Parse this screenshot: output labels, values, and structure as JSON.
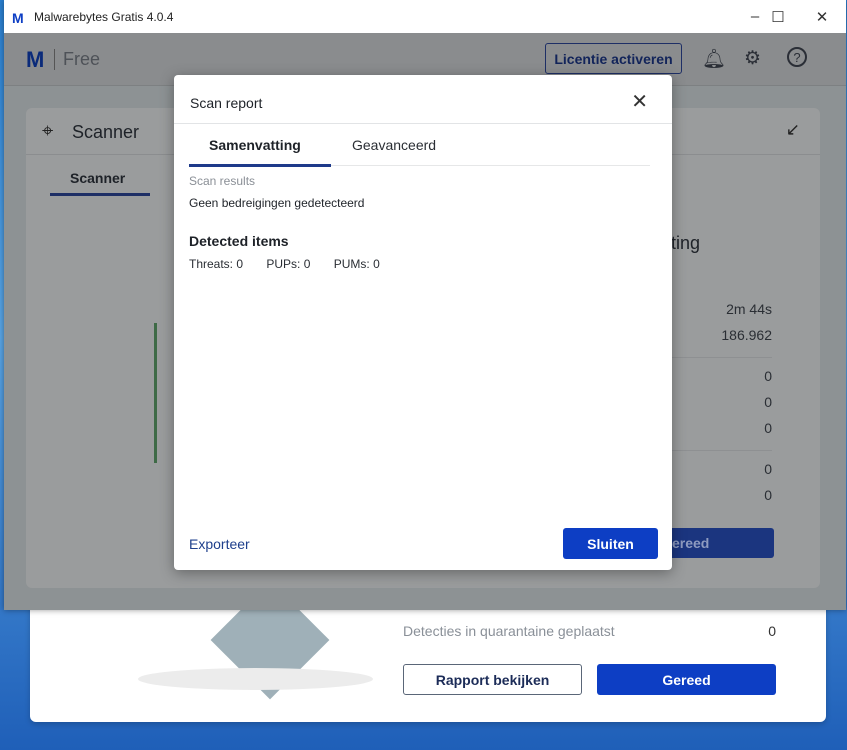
{
  "window": {
    "title": "Malwarebytes Gratis  4.0.4",
    "minimize": "–",
    "maximize": "☐",
    "close": "✕"
  },
  "header": {
    "logo": "M",
    "edition": "Free",
    "license_button": "Licentie activeren",
    "bell": "🔔",
    "gear": "⚙",
    "help": "?"
  },
  "scanner_card": {
    "title": "Scanner",
    "tab": "Scanner",
    "heading_partial": "tting",
    "values": [
      "2m 44s",
      "186.962",
      "0",
      "0",
      "0",
      "0",
      "0"
    ],
    "done_partial": "ereed"
  },
  "background_card": {
    "label": "Detecties in quarantaine geplaatst",
    "value": "0",
    "report_button": "Rapport bekijken",
    "done_button": "Gereed"
  },
  "modal": {
    "title": "Scan report",
    "close": "✕",
    "tabs": [
      "Samenvatting",
      "Geavanceerd"
    ],
    "scan_results_label": "Scan results",
    "scan_results_value": "Geen bedreigingen gedetecteerd",
    "detected_heading": "Detected items",
    "threats": "Threats: 0",
    "pups": "PUPs: 0",
    "pums": "PUMs: 0",
    "export": "Exporteer",
    "close_button": "Sluiten"
  }
}
